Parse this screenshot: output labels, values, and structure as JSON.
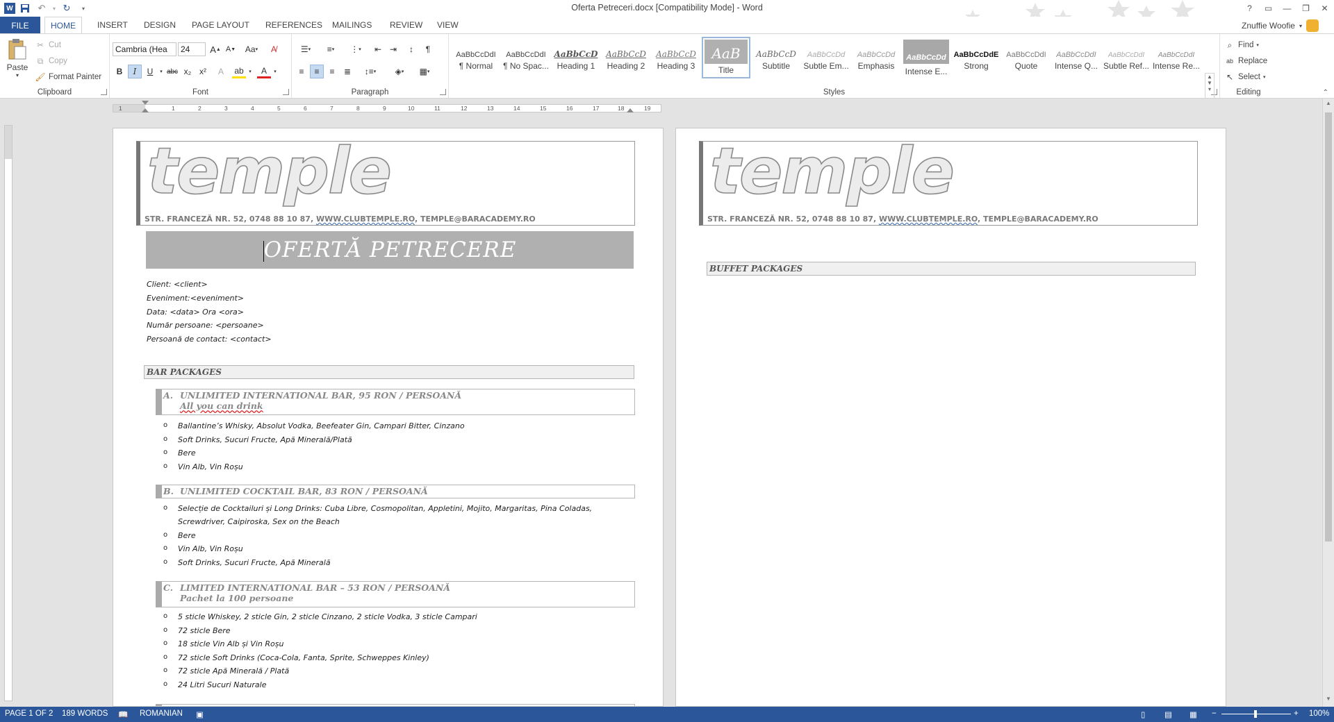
{
  "window": {
    "title": "Oferta Petreceri.docx [Compatibility Mode] - Word",
    "help": "?",
    "restore_ribbon": "▭",
    "minimize": "—",
    "maximize": "❐",
    "close": "✕",
    "user_name": "Znuffie Woofie"
  },
  "tabs": [
    "FILE",
    "HOME",
    "INSERT",
    "DESIGN",
    "PAGE LAYOUT",
    "REFERENCES",
    "MAILINGS",
    "REVIEW",
    "VIEW"
  ],
  "clipboard": {
    "paste": "Paste",
    "cut": "Cut",
    "copy": "Copy",
    "format_painter": "Format Painter",
    "label": "Clipboard"
  },
  "font": {
    "name": "Cambria (Hea",
    "size": "24",
    "label": "Font",
    "bold": "B",
    "italic": "I",
    "underline": "U",
    "strike": "abc",
    "sub": "x₂",
    "sup": "x²",
    "grow": "A",
    "shrink": "A",
    "case": "Aa",
    "effects": "A",
    "highlight": "ab",
    "color": "A"
  },
  "paragraph": {
    "label": "Paragraph"
  },
  "styles": {
    "label": "Styles",
    "items": [
      {
        "preview": "AaBbCcDdI",
        "name": "¶ Normal"
      },
      {
        "preview": "AaBbCcDdI",
        "name": "¶ No Spac..."
      },
      {
        "preview": "AaBbCcD",
        "name": "Heading 1"
      },
      {
        "preview": "AaBbCcD",
        "name": "Heading 2"
      },
      {
        "preview": "AaBbCcD",
        "name": "Heading 3"
      },
      {
        "preview": "AaB",
        "name": "Title"
      },
      {
        "preview": "AaBbCcD",
        "name": "Subtitle"
      },
      {
        "preview": "AaBbCcDd",
        "name": "Subtle Em..."
      },
      {
        "preview": "AaBbCcDd",
        "name": "Emphasis"
      },
      {
        "preview": "AaBbCcDd",
        "name": "Intense E..."
      },
      {
        "preview": "AaBbCcDdE",
        "name": "Strong"
      },
      {
        "preview": "AaBbCcDdI",
        "name": "Quote"
      },
      {
        "preview": "AaBbCcDdI",
        "name": "Intense Q..."
      },
      {
        "preview": "AaBbCcDdI",
        "name": "Subtle Ref..."
      },
      {
        "preview": "AaBbCcDdI",
        "name": "Intense Re..."
      }
    ]
  },
  "editing": {
    "find": "Find",
    "replace": "Replace",
    "select": "Select",
    "label": "Editing"
  },
  "ruler": {
    "numbers": [
      "1",
      "1",
      "2",
      "3",
      "4",
      "5",
      "6",
      "7",
      "8",
      "9",
      "10",
      "11",
      "12",
      "13",
      "14",
      "15",
      "16",
      "17",
      "18",
      "19"
    ]
  },
  "doc": {
    "logo_text": "temple",
    "address_prefix": "STR. FRANCEZĂ NR. 52, 0748 88 10 87, ",
    "address_link": " WWW.CLUBTEMPLE.RO",
    "address_suffix": ", TEMPLE@BARACADEMY.RO",
    "offer_title": "OFERTĂ PETRECERE",
    "info": [
      "Client: <client>",
      "Eveniment:<eveniment>",
      "Data: <data> Ora <ora>",
      "Număr persoane: <persoane>",
      "Persoană de contact: <contact>"
    ],
    "bar_packages": "BAR PACKAGES",
    "package_a": {
      "letter": "A.",
      "title": "UNLIMITED INTERNATIONAL BAR, 95 RON / PERSOANĂ",
      "subtitle": "All you can drink",
      "items": [
        "Ballantine’s Whisky, Absolut Vodka, Beefeater Gin, Campari Bitter, Cinzano",
        "Soft Drinks, Sucuri Fructe, Apă Minerală/Plată",
        "Bere",
        "Vin Alb, Vin Roșu"
      ]
    },
    "package_b": {
      "letter": "B.",
      "title": "UNLIMITED COCKTAIL BAR, 83 RON / PERSOANĂ",
      "items": [
        "Selecție de Cocktailuri și Long Drinks: Cuba Libre, Cosmopolitan, Appletini, Mojito, Margaritas, Pina Coladas,",
        "Screwdriver, Caipiroska, Sex on the Beach",
        "Bere",
        "Vin Alb, Vin Roșu",
        "Soft Drinks, Sucuri Fructe, Apă Minerală"
      ]
    },
    "package_c": {
      "letter": "C.",
      "title": "LIMITED INTERNATIONAL BAR – 53 RON / PERSOANĂ",
      "subtitle": "Pachet la 100 persoane",
      "items": [
        "5 sticle Whiskey, 2 sticle Gin, 2 sticle Cinzano, 2 sticle Vodka, 3 sticle Campari",
        "72 sticle Bere",
        "18 sticle Vin Alb și Vin Roșu",
        "72 sticle Soft Drinks (Coca-Cola, Fanta, Sprite, Schweppes Kinley)",
        "72 sticle Apă Minerală / Plată",
        "24 Litri Sucuri Naturale"
      ]
    },
    "buffet_packages": "BUFFET PACKAGES"
  },
  "status": {
    "page": "PAGE 1 OF 2",
    "words": "189 WORDS",
    "language": "ROMANIAN",
    "zoom": "100%",
    "zoom_value_percent": 100
  },
  "colors": {
    "word_blue": "#2b579a",
    "title_band": "#b0b0b0",
    "pkg_text": "#888888"
  }
}
